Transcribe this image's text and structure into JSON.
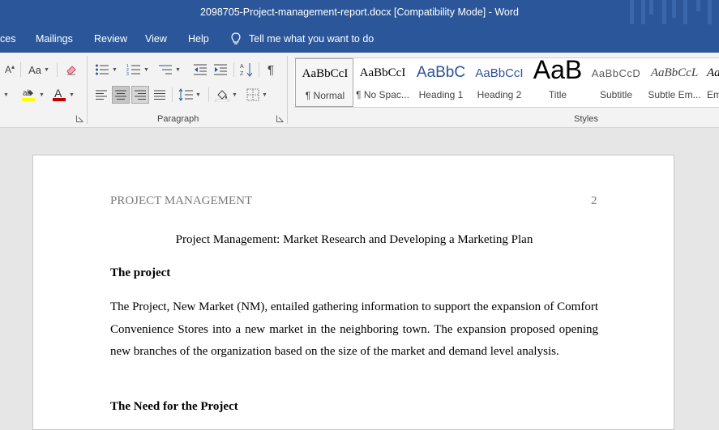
{
  "window": {
    "title": "2098705-Project-management-report.docx [Compatibility Mode]  -  Word"
  },
  "tabs": [
    {
      "label": "ces"
    },
    {
      "label": "Mailings"
    },
    {
      "label": "Review"
    },
    {
      "label": "View"
    },
    {
      "label": "Help"
    }
  ],
  "tell_me": {
    "label": "Tell me what you want to do"
  },
  "font_group": {
    "change_case_label": "Aa",
    "grow_font_label": "A"
  },
  "paragraph_group": {
    "label": "Paragraph"
  },
  "styles_group": {
    "label": "Styles",
    "items": [
      {
        "preview": "AaBbCcI",
        "name": "¶ Normal",
        "color": "#000000"
      },
      {
        "preview": "AaBbCcI",
        "name": "¶ No Spac...",
        "color": "#000000"
      },
      {
        "preview": "AaBbC",
        "name": "Heading 1",
        "color": "#2f5496"
      },
      {
        "preview": "AaBbCcI",
        "name": "Heading 2",
        "color": "#2f5496"
      },
      {
        "preview": "AaB",
        "name": "Title",
        "color": "#000000"
      },
      {
        "preview": "AaBbCcD",
        "name": "Subtitle",
        "color": "#5a5a5a"
      },
      {
        "preview": "AaBbCcL",
        "name": "Subtle Em...",
        "color": "#404040"
      },
      {
        "preview": "Aa",
        "name": "Em",
        "color": "#000000"
      }
    ]
  },
  "colors": {
    "brand": "#2b579a",
    "highlight": "#ffff00",
    "font_color": "#c00000"
  },
  "document": {
    "header_left": "PROJECT MANAGEMENT",
    "header_right": "2",
    "title": "Project Management: Market Research and Developing a Marketing Plan",
    "heading1": "The project",
    "paragraph1": "The Project, New Market (NM), entailed gathering information to support the expansion of Comfort Convenience Stores into a new market in the neighboring town. The expansion proposed opening new branches of the organization based on the size of the market and demand level analysis.",
    "heading2": "The Need for the Project"
  }
}
